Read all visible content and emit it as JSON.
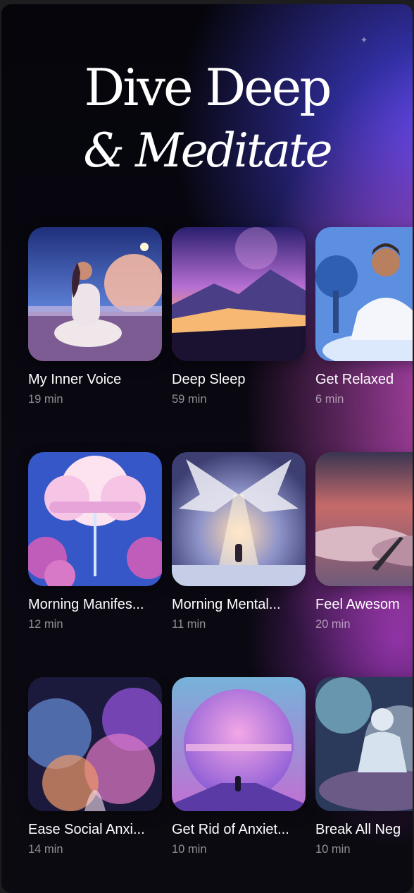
{
  "header": {
    "title_line1": "Dive Deep",
    "title_line2": "& Meditate",
    "sparkle_icon": "sparkle-icon"
  },
  "colors": {
    "background_top_right": "#4a46f5",
    "background_pink": "#d852ce",
    "background_dark": "#05050b",
    "text_primary": "#ffffff",
    "text_secondary": "#a7a7b3"
  },
  "sessions": [
    {
      "title": "My Inner Voice",
      "duration": "19 min",
      "art": "woman meditating by moonlit lake"
    },
    {
      "title": "Deep Sleep",
      "duration": "59 min",
      "art": "purple mountains at sunset"
    },
    {
      "title": "Get Relaxed",
      "duration": "6 min",
      "art": "woman meditating in white"
    },
    {
      "title": "Morning Manifes...",
      "duration": "12 min",
      "art": "pink clouds with rain"
    },
    {
      "title": "Morning Mental...",
      "duration": "11 min",
      "art": "winged light over figure"
    },
    {
      "title": "Feel Awesom",
      "duration": "20 min",
      "art": "stairway above clouds"
    },
    {
      "title": "Ease Social Anxi...",
      "duration": "14 min",
      "art": "swirling cosmic smoke"
    },
    {
      "title": "Get Rid of Anxiet...",
      "duration": "10 min",
      "art": "figure before giant planet"
    },
    {
      "title": "Break All Neg",
      "duration": "10 min",
      "art": "glowing meditating figure"
    }
  ]
}
